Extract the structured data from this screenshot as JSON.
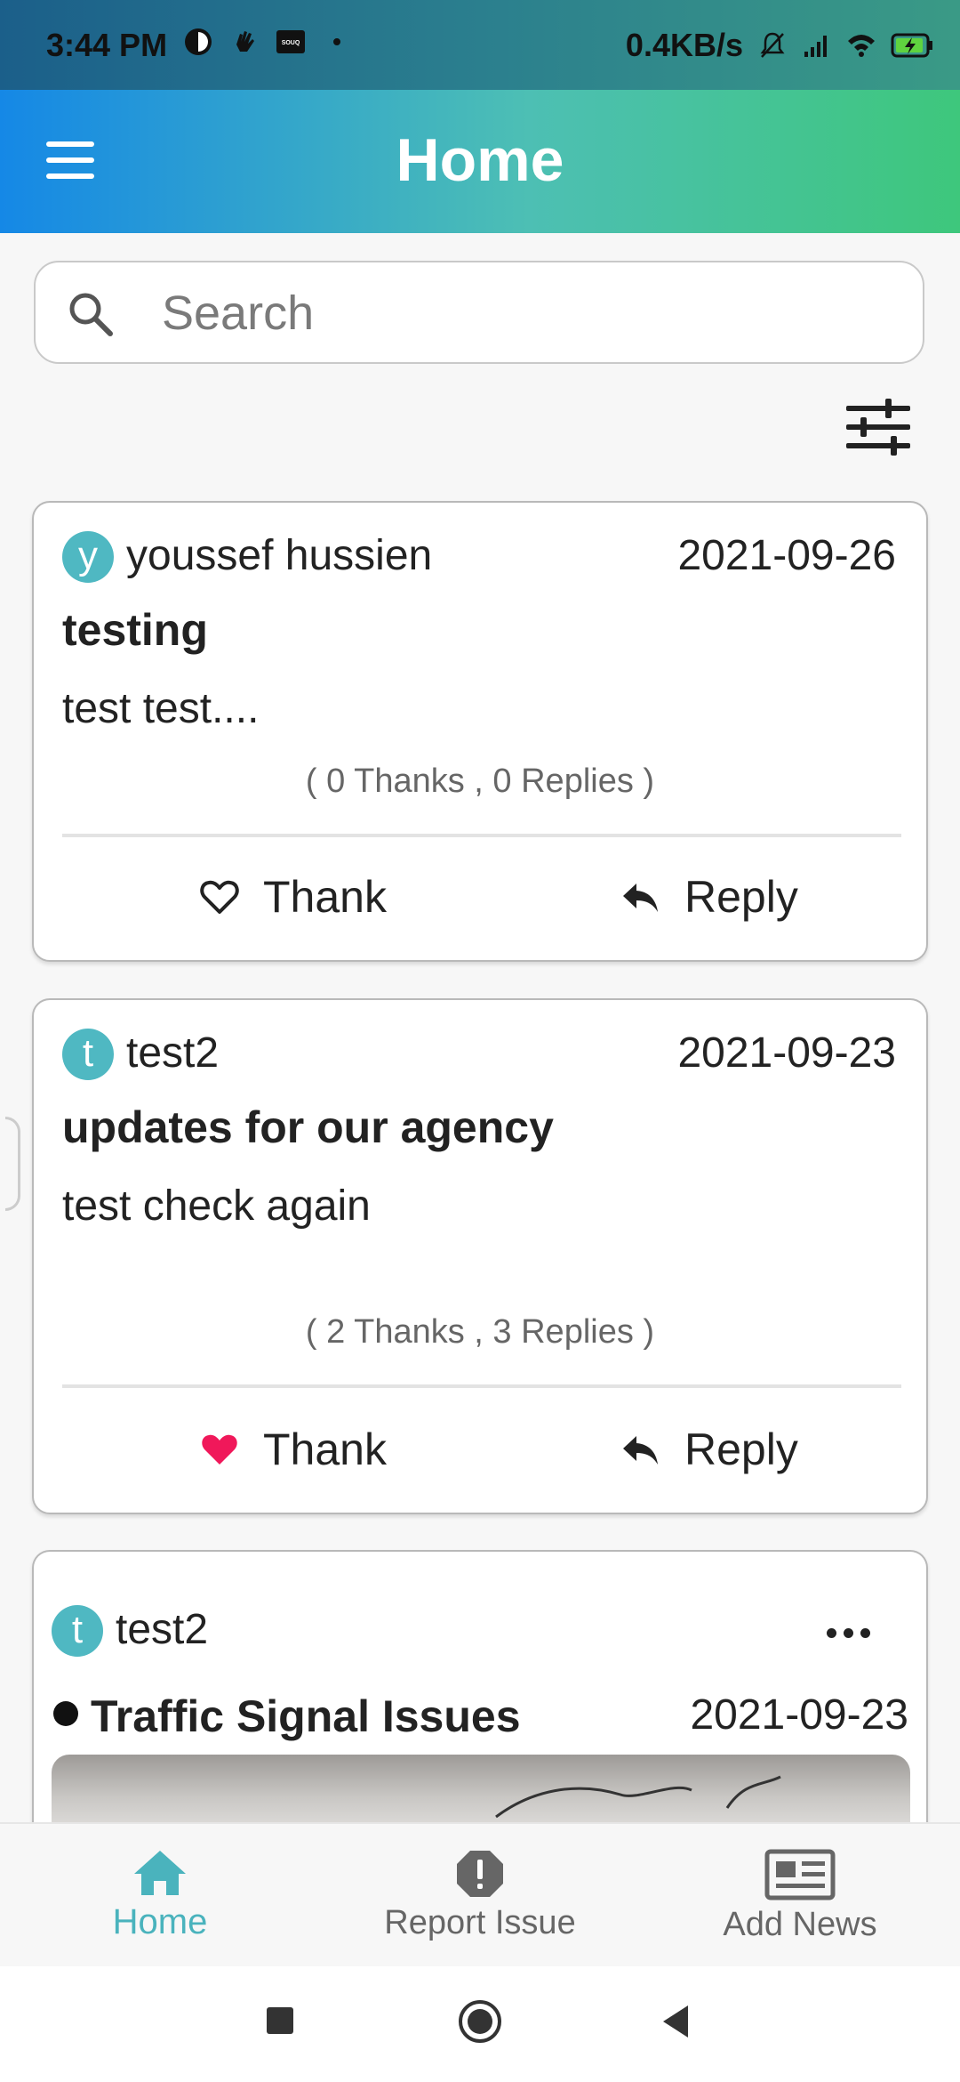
{
  "status_bar": {
    "time": "3:44 PM",
    "net_speed": "0.4KB/s",
    "icons": [
      "app-notification-icon",
      "hand-wave-icon",
      "souq-app-icon",
      "dot-icon",
      "mute-icon",
      "signal-icon",
      "wifi-icon",
      "battery-charging-icon"
    ],
    "souq_label": "SOUQ"
  },
  "app_bar": {
    "title": "Home",
    "menu_icon": "hamburger-menu-icon"
  },
  "search": {
    "placeholder": "Search",
    "value": ""
  },
  "filter": {
    "icon": "sliders-filter-icon"
  },
  "posts": [
    {
      "avatar_letter": "y",
      "author": "youssef hussien",
      "date": "2021-09-26",
      "title": "testing",
      "body": "test test....",
      "counts": "( 0 Thanks , 0 Replies )",
      "thank_label": "Thank",
      "reply_label": "Reply",
      "thanked": false
    },
    {
      "avatar_letter": "t",
      "author": "test2",
      "date": "2021-09-23",
      "title": "updates for our agency",
      "body": "test check again",
      "counts": "( 2 Thanks , 3 Replies )",
      "thank_label": "Thank",
      "reply_label": "Reply",
      "thanked": true
    }
  ],
  "issue": {
    "avatar_letter": "t",
    "author": "test2",
    "title": "Traffic Signal Issues",
    "date": "2021-09-23",
    "more_icon": "more-horizontal-icon"
  },
  "bottom_nav": {
    "items": [
      {
        "label": "Home",
        "icon": "home-icon",
        "active": true
      },
      {
        "label": "Report Issue",
        "icon": "alert-octagon-icon",
        "active": false
      },
      {
        "label": "Add News",
        "icon": "newspaper-icon",
        "active": false
      }
    ]
  },
  "colors": {
    "accent": "#4ab3bd",
    "heart_active": "#f0185a",
    "app_bar_start": "#1588e6",
    "app_bar_end": "#3ec77c"
  }
}
